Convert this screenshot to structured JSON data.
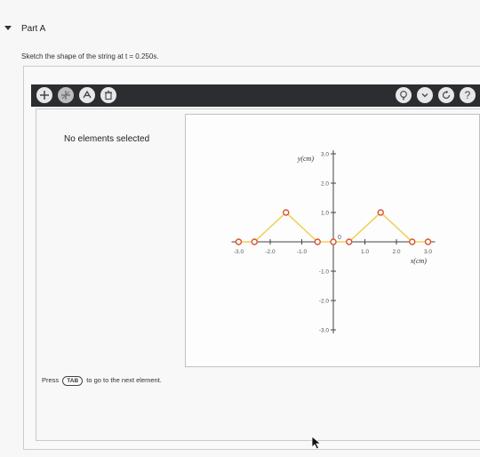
{
  "part": {
    "title": "Part A"
  },
  "prompt": "Sketch the shape of the string at t = 0.250s.",
  "toolbar": {
    "left_tools": [
      "add-point",
      "delete-point-disabled",
      "label",
      "trash"
    ],
    "right_tools": [
      "hint-bulb",
      "dropdown",
      "reset",
      "help"
    ],
    "help_label": "?"
  },
  "panel": {
    "status": "No elements selected",
    "hint_before": "Press",
    "hint_key": "TAB",
    "hint_after": "to go to the next element."
  },
  "colors": {
    "toolbar_bg": "#2b2d30",
    "line": "#f2d060",
    "point": "#d9532e"
  },
  "chart_data": {
    "type": "line",
    "xlabel": "x(cm)",
    "ylabel": "y(cm)",
    "xlim": [
      -3.0,
      3.0
    ],
    "ylim": [
      -3.0,
      3.0
    ],
    "x_ticks": [
      "-3.0",
      "-2.0",
      "-1.0",
      "1.0",
      "2.0",
      "3.0"
    ],
    "y_ticks": [
      "3.0",
      "2.0",
      "1.0",
      "-1.0",
      "-2.0",
      "-3.0"
    ],
    "origin_label": "0",
    "grid": false,
    "series": [
      {
        "points": [
          [
            -3.0,
            0
          ],
          [
            -2.5,
            0
          ],
          [
            -1.5,
            1.0
          ],
          [
            -0.5,
            0
          ],
          [
            0,
            0
          ],
          [
            0.5,
            0
          ],
          [
            1.5,
            1.0
          ],
          [
            2.5,
            0
          ],
          [
            3.0,
            0
          ]
        ]
      }
    ]
  }
}
